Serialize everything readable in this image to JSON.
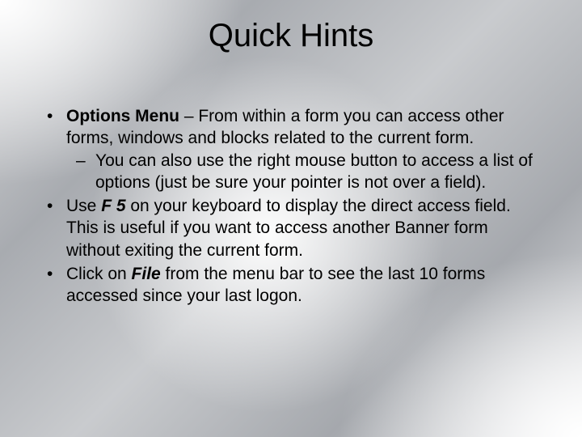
{
  "title": "Quick Hints",
  "bullets": {
    "b1_bold": "Options Menu",
    "b1_rest": " – From within a form you can access other forms, windows and blocks related to the current form.",
    "b1_sub": "You can also use the right mouse button to access a list of options (just be sure your pointer is not over a field).",
    "b2_a": "Use ",
    "b2_key": "F 5",
    "b2_b": " on your keyboard to display the direct access field.  This is useful if you want to access another Banner form without exiting the current form.",
    "b3_a": "Click on ",
    "b3_key": "File",
    "b3_b": " from the menu bar to see the last 10 forms accessed since your last logon."
  }
}
